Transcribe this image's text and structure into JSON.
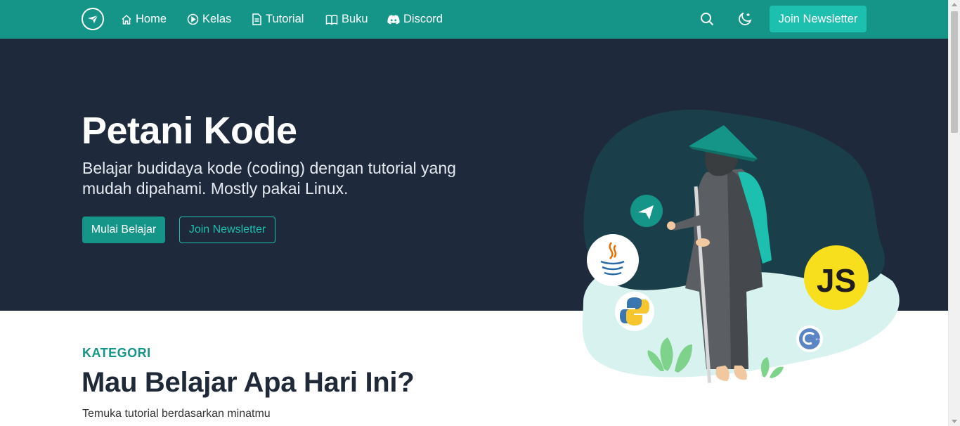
{
  "nav": {
    "links": [
      {
        "label": "Home",
        "icon": "home-icon"
      },
      {
        "label": "Kelas",
        "icon": "play-circle-icon"
      },
      {
        "label": "Tutorial",
        "icon": "document-icon"
      },
      {
        "label": "Buku",
        "icon": "book-icon"
      },
      {
        "label": "Discord",
        "icon": "discord-icon"
      }
    ],
    "cta_label": "Join Newsletter"
  },
  "hero": {
    "title": "Petani Kode",
    "subtitle": "Belajar budidaya kode (coding) dengan tutorial yang mudah dipahami. Mostly pakai Linux.",
    "primary_button": "Mulai Belajar",
    "secondary_button": "Join Newsletter",
    "badge_js": "JS"
  },
  "category": {
    "label": "KATEGORI",
    "title": "Mau Belajar Apa Hari Ini?",
    "subtitle": "Temuka tutorial berdasarkan minatmu"
  },
  "colors": {
    "nav_bg": "#159488",
    "hero_bg": "#1e293b",
    "accent": "#1dbfae",
    "js_yellow": "#f7df1e"
  }
}
